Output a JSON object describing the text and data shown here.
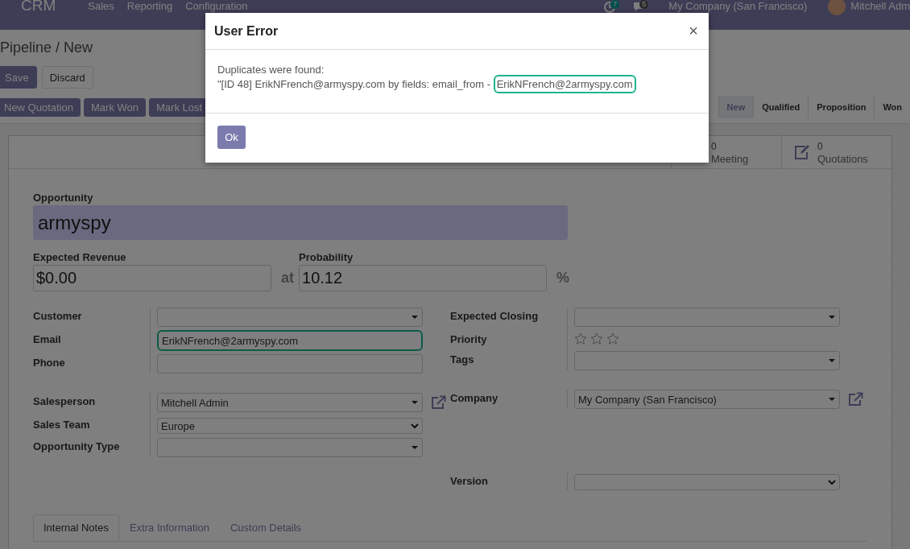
{
  "navbar": {
    "app": "CRM",
    "menus": [
      "Sales",
      "Reporting",
      "Configuration"
    ],
    "badges": [
      "7",
      "5"
    ],
    "company": "My Company (San Francisco)",
    "user": "Mitchell Adm"
  },
  "breadcrumb": "Pipeline / New",
  "buttons": [
    "Save",
    "Discard"
  ],
  "actions": [
    "New Quotation",
    "Mark Won",
    "Mark Lost"
  ],
  "stages": [
    {
      "label": "New",
      "selected": true
    },
    {
      "label": "Qualified",
      "selected": false
    },
    {
      "label": "Proposition",
      "selected": false
    },
    {
      "label": "Won",
      "selected": false
    }
  ],
  "stat_buttons": [
    {
      "count": "0",
      "label": "Meeting"
    },
    {
      "count": "0",
      "label": "Quotations"
    }
  ],
  "opportunity": {
    "label": "Opportunity",
    "value": "armyspy"
  },
  "revenue": {
    "label": "Expected Revenue",
    "value": "$0.00"
  },
  "at": "at",
  "probability": {
    "label": "Probability",
    "value": "10.12",
    "unit": "%"
  },
  "left_groups": [
    [
      {
        "label": "Customer",
        "kind": "dropdown"
      },
      {
        "label": "Email",
        "kind": "input",
        "value": "ErikNFrench@2armyspy.com",
        "highlighted": true
      },
      {
        "label": "Phone",
        "kind": "input",
        "highlighted": false
      }
    ],
    [
      {
        "label": "Salesperson",
        "kind": "dropdown",
        "value": "Mitchell Admin",
        "link": true
      },
      {
        "label": "Sales Team",
        "kind": "select",
        "value": "Europe"
      },
      {
        "label": "Opportunity Type",
        "kind": "dropdown"
      }
    ]
  ],
  "right_groups": [
    [
      {
        "label": "Expected Closing",
        "kind": "dropdown"
      },
      {
        "label": "Priority",
        "kind": "stars",
        "stars": 0
      },
      {
        "label": "Tags",
        "kind": "dropdown"
      }
    ],
    [
      {
        "label": "Company",
        "kind": "dropdown",
        "value": "My Company (San Francisco)",
        "link": true
      }
    ],
    [
      {
        "label": "Version",
        "kind": "select"
      }
    ]
  ],
  "tabs": [
    {
      "label": "Internal Notes",
      "selected": true
    },
    {
      "label": "Extra Information",
      "selected": false
    },
    {
      "label": "Custom Details",
      "selected": false
    }
  ],
  "dialog": {
    "title": "User Error",
    "close": "×",
    "line1": "Duplicates were found:",
    "line2": "\"[ID 48] ErikNFrench@armyspy.com  by fields:  email_from -",
    "match": "ErikNFrench@2armyspy.com",
    "button": "Ok"
  }
}
